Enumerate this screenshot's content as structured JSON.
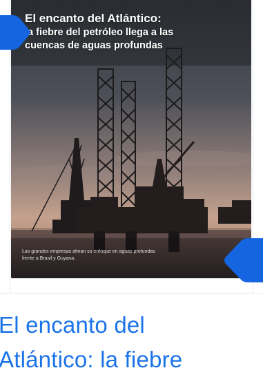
{
  "cover": {
    "title_line1": "El encanto del Atlántico:",
    "title_line2": "la fiebre del petróleo llega a las",
    "title_line3": "cuencas de aguas profundas",
    "caption_line1": "Las grandes empresas afinan su enfoque en aguas profundas",
    "caption_line2": "frente a Brasil y Guyana."
  },
  "headline": {
    "line1": "El encanto del",
    "line2": "Atlántico: la fiebre"
  },
  "icons": {
    "prev": "chevron-left-icon",
    "next": "chevron-right-icon"
  },
  "colors": {
    "accent": "#1a73e8",
    "arrow": "#1565e0",
    "sky_top": "#3a3f4a",
    "sky_bottom": "#c9a78f"
  }
}
